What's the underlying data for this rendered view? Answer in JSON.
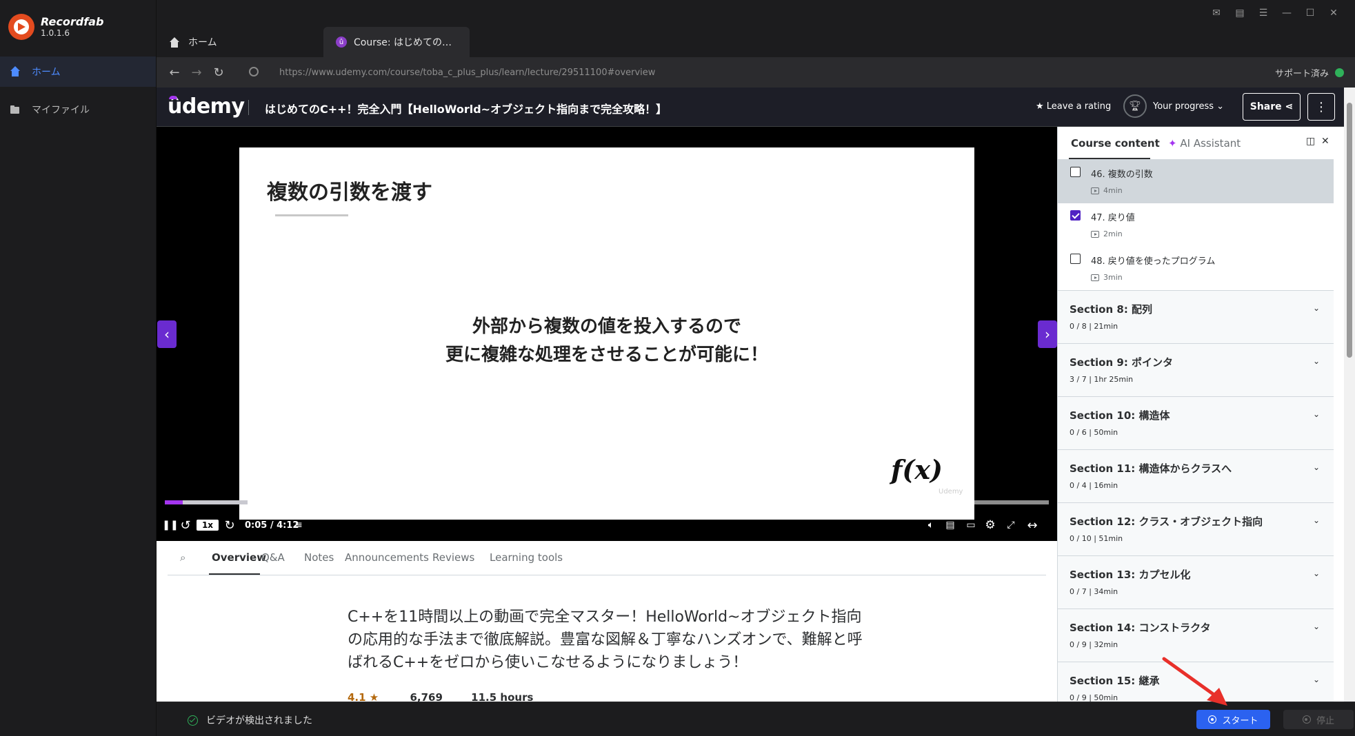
{
  "app": {
    "name": "Recordfab",
    "version": "1.0.1.6",
    "nav": [
      {
        "label": "ホーム",
        "icon": "home-icon",
        "active": true
      },
      {
        "label": "マイファイル",
        "icon": "folder-icon",
        "active": false
      }
    ]
  },
  "tabs": [
    {
      "label": "ホーム",
      "icon": "home-icon"
    },
    {
      "label": "Course: はじめての…",
      "icon": "udemy-favicon"
    }
  ],
  "address": {
    "url": "https://www.udemy.com/course/toba_c_plus_plus/learn/lecture/29511100#overview",
    "support_status": "サポート済み",
    "support_color": "#2fb15a"
  },
  "udemy": {
    "logo": "ûdemy",
    "course_title": "はじめてのC++！完全入門【HelloWorld~オブジェクト指向まで完全攻略！】",
    "rating_link": "Leave a rating",
    "progress_label": "Your progress",
    "share_label": "Share",
    "accent_color": "#a435f0"
  },
  "video": {
    "slide_title": "複数の引数を渡す",
    "slide_line1": "外部から複数の値を投入するので",
    "slide_line2": "更に複雑な処理をさせることが可能に！",
    "slide_fx": "f(x)",
    "slide_watermark": "Udemy",
    "speed": "1x",
    "time": "0:05 / 4:12",
    "progress": 0.02
  },
  "content_tabs": [
    "Overview",
    "Q&A",
    "Notes",
    "Announcements",
    "Reviews",
    "Learning tools"
  ],
  "overview": {
    "description": "C++を11時間以上の動画で完全マスター！HelloWorld~オブジェクト指向の応用的な手法まで徹底解説。豊富な図解＆丁寧なハンズオンで、難解と呼ばれるC++をゼロから使いこなせるようになりましょう！",
    "stat_rating": "4.1 ★",
    "stat_count": "6,769",
    "stat_hours": "11.5 hours"
  },
  "sidebar": {
    "tab_content": "Course content",
    "tab_ai": "AI Assistant",
    "lectures": [
      {
        "title": "46. 複数の引数",
        "duration": "4min",
        "checked": false,
        "current": true
      },
      {
        "title": "47. 戻り値",
        "duration": "2min",
        "checked": true,
        "current": false
      },
      {
        "title": "48. 戻り値を使ったプログラム",
        "duration": "3min",
        "checked": false,
        "current": false
      }
    ],
    "sections": [
      {
        "title": "Section 8: 配列",
        "meta": "0 / 8 | 21min"
      },
      {
        "title": "Section 9: ポインタ",
        "meta": "3 / 7 | 1hr 25min"
      },
      {
        "title": "Section 10: 構造体",
        "meta": "0 / 6 | 50min"
      },
      {
        "title": "Section 11: 構造体からクラスへ",
        "meta": "0 / 4 | 16min"
      },
      {
        "title": "Section 12: クラス・オブジェクト指向",
        "meta": "0 / 10 | 51min"
      },
      {
        "title": "Section 13: カプセル化",
        "meta": "0 / 7 | 34min"
      },
      {
        "title": "Section 14: コンストラクタ",
        "meta": "0 / 9 | 32min"
      },
      {
        "title": "Section 15: 継承",
        "meta": "0 / 9 | 50min"
      }
    ]
  },
  "bottom": {
    "detected": "ビデオが検出されました",
    "start": "スタート",
    "stop": "停止",
    "start_color": "#2b62f0"
  }
}
